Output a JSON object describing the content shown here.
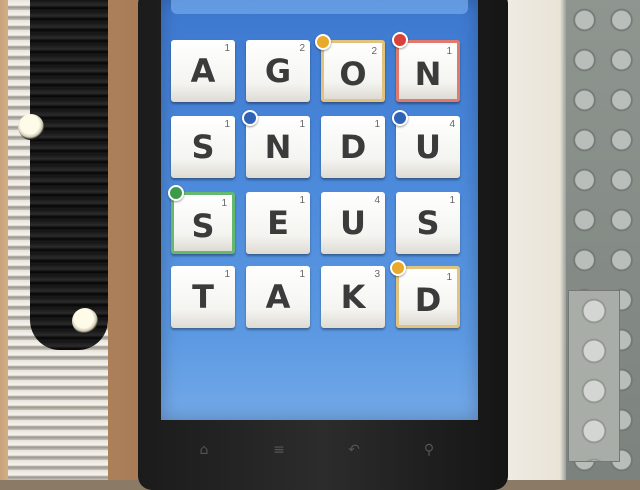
{
  "board": {
    "rows": [
      [
        {
          "letter": "A",
          "points": "1",
          "bonus": ""
        },
        {
          "letter": "G",
          "points": "2",
          "bonus": ""
        },
        {
          "letter": "O",
          "points": "2",
          "bonus": "dl"
        },
        {
          "letter": "N",
          "points": "1",
          "bonus": "tl"
        }
      ],
      [
        {
          "letter": "S",
          "points": "1",
          "bonus": ""
        },
        {
          "letter": "N",
          "points": "1",
          "bonus": "blue"
        },
        {
          "letter": "D",
          "points": "1",
          "bonus": ""
        },
        {
          "letter": "U",
          "points": "4",
          "bonus": "blue"
        }
      ],
      [
        {
          "letter": "S",
          "points": "1",
          "bonus": "dw"
        },
        {
          "letter": "E",
          "points": "1",
          "bonus": ""
        },
        {
          "letter": "U",
          "points": "4",
          "bonus": ""
        },
        {
          "letter": "S",
          "points": "1",
          "bonus": ""
        }
      ],
      [
        {
          "letter": "T",
          "points": "1",
          "bonus": ""
        },
        {
          "letter": "A",
          "points": "1",
          "bonus": ""
        },
        {
          "letter": "K",
          "points": "3",
          "bonus": ""
        },
        {
          "letter": "D",
          "points": "1",
          "bonus": "dl"
        }
      ]
    ]
  },
  "colors": {
    "screen_blue": "#4a88da",
    "badge_gold": "#e9a92a",
    "badge_red": "#d9423a",
    "badge_blue": "#2f63b8",
    "badge_green": "#3c9a4a"
  },
  "nav_icons": [
    "back-icon",
    "home-icon",
    "menu-icon",
    "search-icon"
  ]
}
